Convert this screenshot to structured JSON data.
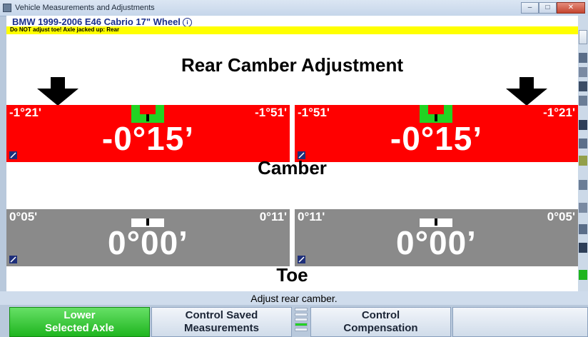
{
  "window": {
    "title": "Vehicle Measurements and Adjustments"
  },
  "vehicle": {
    "title": "BMW 1999-2006 E46 Cabrio 17\" Wheel",
    "info_symbol": "i"
  },
  "warning": {
    "text": "Do NOT adjust toe! Axle jacked up: Rear"
  },
  "main": {
    "title": "Rear Camber Adjustment",
    "camber_label": "Camber",
    "toe_label": "Toe"
  },
  "gauges": {
    "camber_left": {
      "min": "-1°21'",
      "max": "-1°51'",
      "value": "-0°15’",
      "status_color": "#ff0000"
    },
    "camber_right": {
      "min": "-1°51'",
      "max": "-1°21'",
      "value": "-0°15’",
      "status_color": "#ff0000"
    },
    "toe_left": {
      "min": "0°05'",
      "max": "0°11'",
      "value": "0°00’",
      "status_color": "#8a8a8a"
    },
    "toe_right": {
      "min": "0°11'",
      "max": "0°05'",
      "value": "0°00’",
      "status_color": "#8a8a8a"
    }
  },
  "status": {
    "text": "Adjust rear camber."
  },
  "fkeys": {
    "f1": {
      "line1": "Lower",
      "line2": "Selected Axle"
    },
    "f2": {
      "line1": "Control Saved",
      "line2": "Measurements"
    },
    "f3": {
      "line1": "Control",
      "line2": "Compensation"
    },
    "f4": {
      "line1": "",
      "line2": ""
    }
  },
  "colors": {
    "in_spec": "#22d322",
    "out_of_spec": "#ff0000",
    "neutral": "#8a8a8a",
    "vehicle_title": "#1a2f8c",
    "warning": "#ffff00"
  }
}
